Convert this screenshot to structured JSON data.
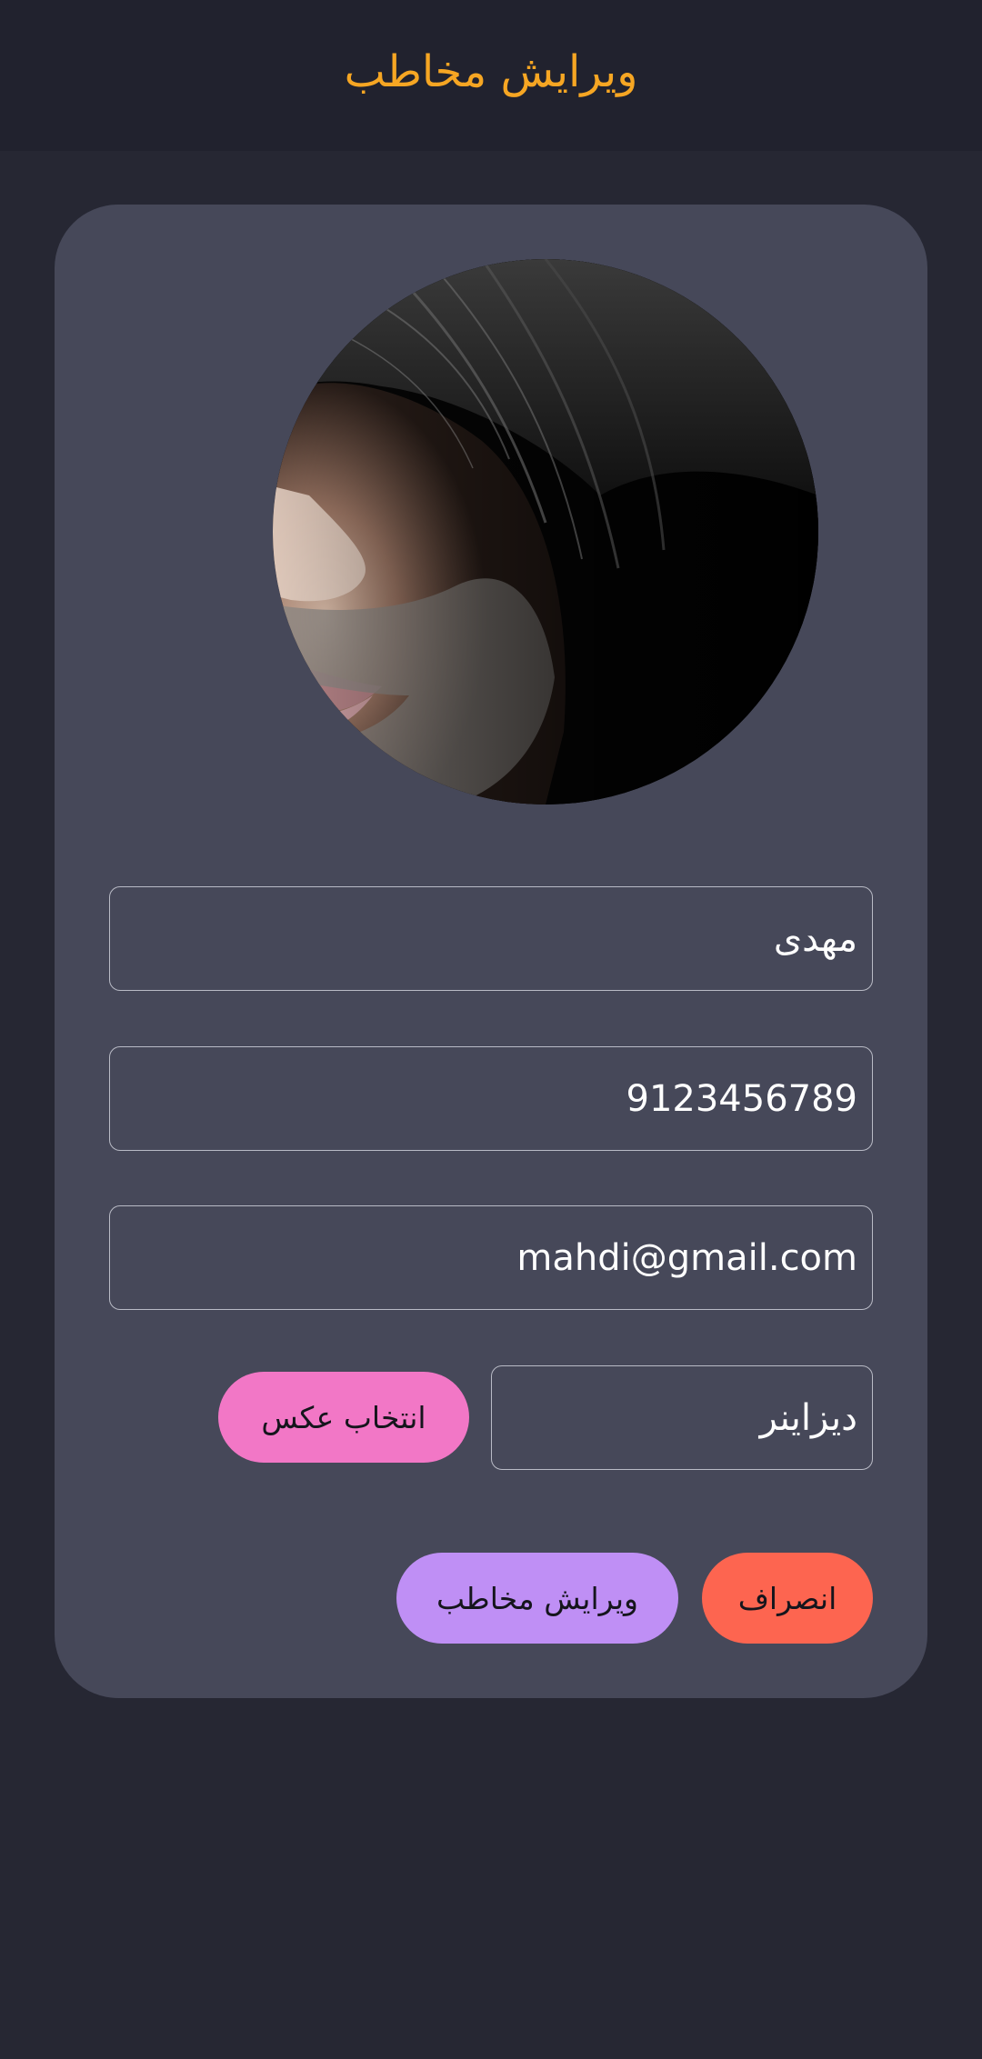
{
  "appbar": {
    "title": "ویرایش مخاطب"
  },
  "avatar": {
    "alt": "contact photo"
  },
  "form": {
    "name_value": "مهدی",
    "phone_value": "9123456789",
    "email_value": "mahdi@gmail.com",
    "job_value": "دیزاینر"
  },
  "buttons": {
    "pick_image_label": "انتخاب عکس",
    "edit_label": "ویرایش مخاطب",
    "cancel_label": "انصراف"
  },
  "colors": {
    "background": "#262733",
    "appbar": "#21222e",
    "card": "#464859",
    "title": "#f6a623",
    "pick_image_button": "#f277c6",
    "edit_button": "#bf8ff5",
    "cancel_button": "#fd6550"
  }
}
